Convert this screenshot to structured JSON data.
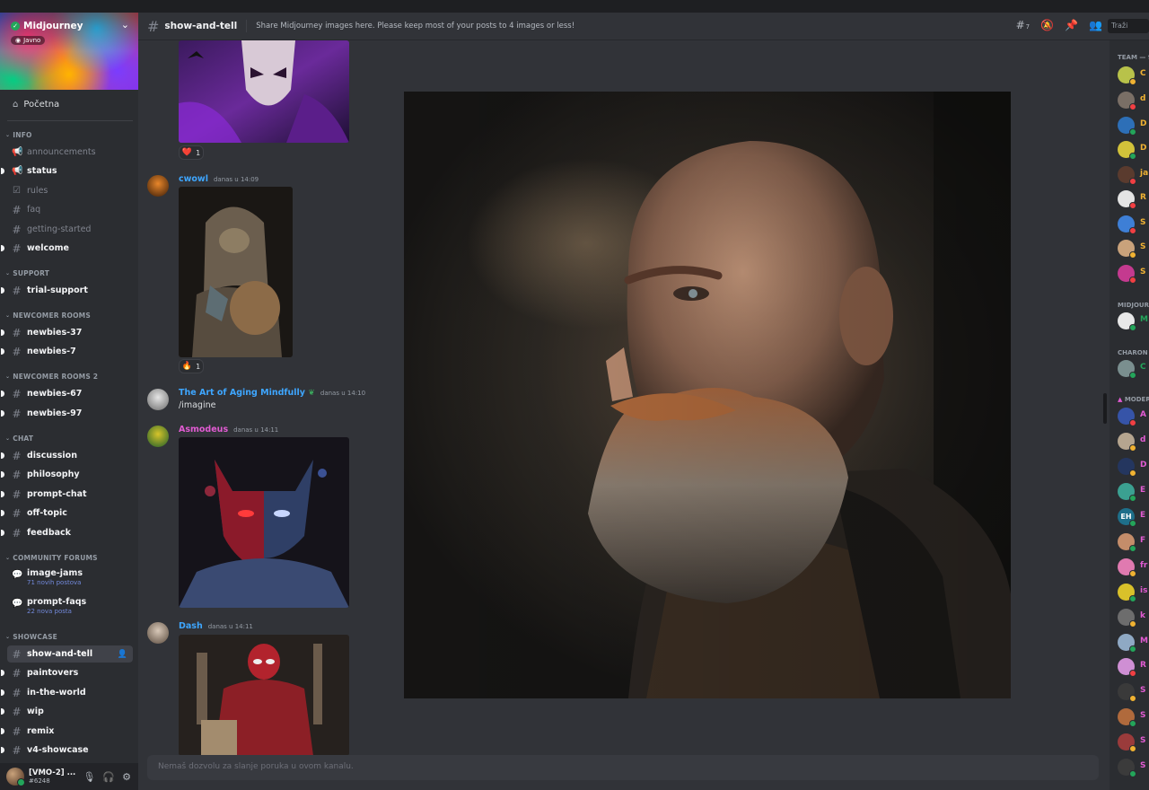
{
  "server": {
    "name": "Midjourney",
    "public_label": "Javno",
    "home_label": "Početna"
  },
  "categories": {
    "info": "INFO",
    "support": "SUPPORT",
    "newcomer1": "NEWCOMER ROOMS",
    "newcomer2": "NEWCOMER ROOMS 2",
    "chat": "CHAT",
    "forums": "COMMUNITY FORUMS",
    "showcase": "SHOWCASE"
  },
  "channels": {
    "announcements": "announcements",
    "status": "status",
    "rules": "rules",
    "faq": "faq",
    "getting_started": "getting-started",
    "welcome": "welcome",
    "trial_support": "trial-support",
    "newbies_37": "newbies-37",
    "newbies_7": "newbies-7",
    "newbies_67": "newbies-67",
    "newbies_97": "newbies-97",
    "discussion": "discussion",
    "philosophy": "philosophy",
    "prompt_chat": "prompt-chat",
    "off_topic": "off-topic",
    "feedback": "feedback",
    "image_jams": "image-jams",
    "image_jams_sub": "71 novih postova",
    "prompt_faqs": "prompt-faqs",
    "prompt_faqs_sub": "22 nova posta",
    "show_and_tell": "show-and-tell",
    "paintovers": "paintovers",
    "in_the_world": "in-the-world",
    "wip": "wip",
    "remix": "remix",
    "v4_showcase": "v4-showcase"
  },
  "user": {
    "name": "[VMO-2] ...",
    "tag": "#6248"
  },
  "header": {
    "channel": "show-and-tell",
    "topic": "Share Midjourney images here. Please keep most of your posts to 4 images or less!",
    "threads_count": "7",
    "search_placeholder": "Traži"
  },
  "messages": [
    {
      "author": "cwowl",
      "time": "danas u 14:09",
      "color": "#3ea6ff"
    },
    {
      "author": "The Art of Aging Mindfully",
      "time": "danas u 14:10",
      "text": "/imagine",
      "color": "#3ea6ff"
    },
    {
      "author": "Asmodeus",
      "time": "danas u 14:11",
      "color": "#e15bd2"
    },
    {
      "author": "Dash",
      "time": "danas u 14:11",
      "color": "#3ea6ff"
    }
  ],
  "reactions": [
    {
      "emoji": "❤️",
      "count": "1"
    },
    {
      "emoji": "🔥",
      "count": "1"
    }
  ],
  "input_placeholder": "Nemaš dozvolu za slanje poruka u ovom kanalu.",
  "member_categories": {
    "team": "TEAM — 9",
    "midjourney": "MIDJOURNEY",
    "charon": "CHARON THE...",
    "moderators": "MODERATORS"
  },
  "members": [
    {
      "initial": "C",
      "color": "#f0b232"
    },
    {
      "initial": "d",
      "color": "#f0b232"
    },
    {
      "initial": "D",
      "color": "#f0b232"
    },
    {
      "initial": "D",
      "color": "#f0b232"
    },
    {
      "initial": "ja",
      "color": "#f0b232"
    },
    {
      "initial": "R",
      "color": "#f0b232"
    },
    {
      "initial": "S",
      "color": "#f0b232"
    },
    {
      "initial": "S",
      "color": "#f0b232"
    },
    {
      "initial": "S",
      "color": "#f0b232"
    },
    {
      "initial": "M",
      "color": "#23a55a"
    },
    {
      "initial": "C",
      "color": "#23a55a"
    },
    {
      "initial": "A",
      "color": "#e15bd2"
    },
    {
      "initial": "d",
      "color": "#e15bd2"
    },
    {
      "initial": "D",
      "color": "#e15bd2"
    },
    {
      "initial": "E",
      "color": "#e15bd2"
    },
    {
      "initial": "E",
      "color": "#e15bd2"
    },
    {
      "initial": "F",
      "color": "#e15bd2"
    },
    {
      "initial": "fr",
      "color": "#e15bd2"
    },
    {
      "initial": "is",
      "color": "#e15bd2"
    },
    {
      "initial": "k",
      "color": "#e15bd2"
    },
    {
      "initial": "M",
      "color": "#e15bd2"
    },
    {
      "initial": "R",
      "color": "#e15bd2"
    },
    {
      "initial": "S",
      "color": "#e15bd2"
    },
    {
      "initial": "S",
      "color": "#e15bd2"
    },
    {
      "initial": "S",
      "color": "#e15bd2"
    },
    {
      "initial": "S",
      "color": "#e15bd2"
    }
  ],
  "member_avatar_label": "EH",
  "colors": {
    "accent": "#5865f2",
    "online": "#23a55a",
    "idle": "#f0b232",
    "dnd": "#f23f43"
  }
}
